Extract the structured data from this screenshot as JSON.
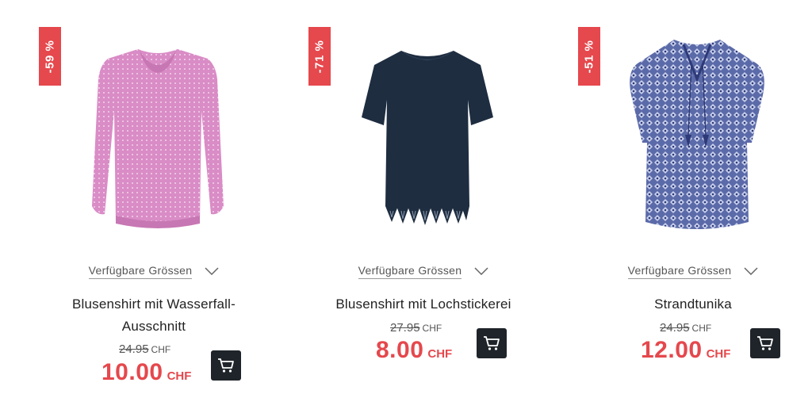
{
  "colors": {
    "sale_red": "#e5484d",
    "cart_button": "#1f242a",
    "text_dark": "#222222",
    "text_muted": "#555555"
  },
  "products": [
    {
      "discount": "-59 %",
      "image_icon": "pink-blouse-image",
      "sizes_label": "Verfügbare Grössen",
      "title": "Blusenshirt mit Wasserfall-Ausschnitt",
      "old_price": "24.95",
      "old_currency": "CHF",
      "new_price": "10.00",
      "new_currency": "CHF"
    },
    {
      "discount": "-71 %",
      "image_icon": "navy-shirt-image",
      "sizes_label": "Verfügbare Grössen",
      "title": "Blusenshirt mit Lochstickerei",
      "old_price": "27.95",
      "old_currency": "CHF",
      "new_price": "8.00",
      "new_currency": "CHF"
    },
    {
      "discount": "-51 %",
      "image_icon": "blue-tunic-image",
      "sizes_label": "Verfügbare Grössen",
      "title": "Strandtunika",
      "old_price": "24.95",
      "old_currency": "CHF",
      "new_price": "12.00",
      "new_currency": "CHF"
    }
  ]
}
